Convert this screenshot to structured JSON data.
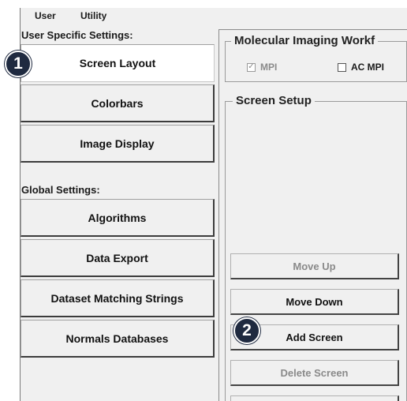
{
  "menu": {
    "user": "User",
    "utility": "Utility"
  },
  "left": {
    "user_specific_label": "User Specific Settings:",
    "global_label": "Global Settings:",
    "user_buttons": [
      "Screen Layout",
      "Colorbars",
      "Image Display"
    ],
    "global_buttons": [
      "Algorithms",
      "Data Export",
      "Dataset Matching Strings",
      "Normals Databases"
    ]
  },
  "workflow": {
    "title": "Molecular Imaging Workf",
    "options": [
      {
        "label": "MPI",
        "checked": true,
        "disabled": true
      },
      {
        "label": "AC MPI",
        "checked": false,
        "disabled": false
      }
    ]
  },
  "screen_setup": {
    "title": "Screen Setup",
    "buttons": [
      {
        "label": "Move Up",
        "disabled": true
      },
      {
        "label": "Move Down",
        "disabled": false
      },
      {
        "label": "Add Screen",
        "disabled": false
      },
      {
        "label": "Delete Screen",
        "disabled": true
      }
    ]
  },
  "callouts": [
    "1",
    "2"
  ],
  "colors": {
    "badge": "#1f2a40",
    "panel": "#f0f0f0",
    "selected": "#ffffff"
  }
}
